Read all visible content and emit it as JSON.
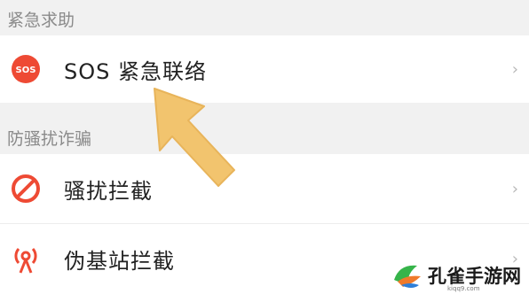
{
  "sections": [
    {
      "header": "紧急求助",
      "items": [
        {
          "label": "SOS 紧急联络",
          "icon": "sos-icon",
          "icon_text": "SOS",
          "chevron": "›"
        }
      ]
    },
    {
      "header": "防骚扰诈骗",
      "items": [
        {
          "label": "骚扰拦截",
          "icon": "block-icon",
          "chevron": "›"
        },
        {
          "label": "伪基站拦截",
          "icon": "signal-tower-icon",
          "chevron": "›"
        }
      ]
    }
  ],
  "colors": {
    "accent_red": "#ee4a34",
    "arrow_yellow": "#f2c46e",
    "background": "#f1f1f1"
  },
  "watermark": {
    "text": "孔雀手游网",
    "sub": "kiqq9.com"
  }
}
